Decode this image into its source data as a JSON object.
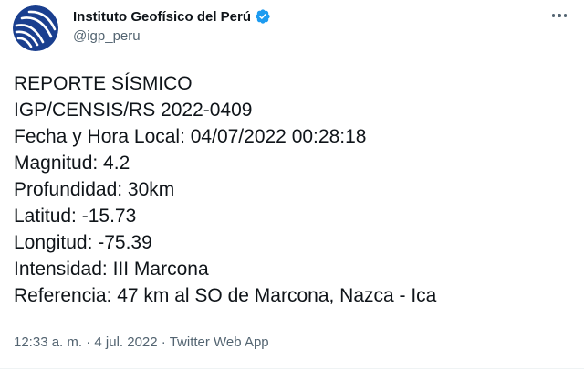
{
  "author": {
    "display_name": "Instituto Geofísico del Perú",
    "handle": "@igp_peru",
    "verified": true
  },
  "tweet": {
    "lines": [
      "REPORTE SÍSMICO",
      "IGP/CENSIS/RS 2022-0409",
      "Fecha y Hora Local: 04/07/2022 00:28:18",
      "Magnitud: 4.2",
      "Profundidad: 30km",
      "Latitud: -15.73",
      "Longitud: -75.39",
      "Intensidad: III Marcona",
      "Referencia: 47 km al SO de Marcona, Nazca - Ica"
    ],
    "time": "12:33 a. m.",
    "separator": "·",
    "date": "4 jul. 2022",
    "source": "Twitter Web App"
  },
  "colors": {
    "avatar_blue": "#1a3f8f",
    "verified_blue": "#1d9bf0",
    "secondary_text": "#536471"
  },
  "icons": {
    "avatar": "igp-logo-icon",
    "verified": "verified-badge-icon",
    "more": "more-options-icon"
  }
}
